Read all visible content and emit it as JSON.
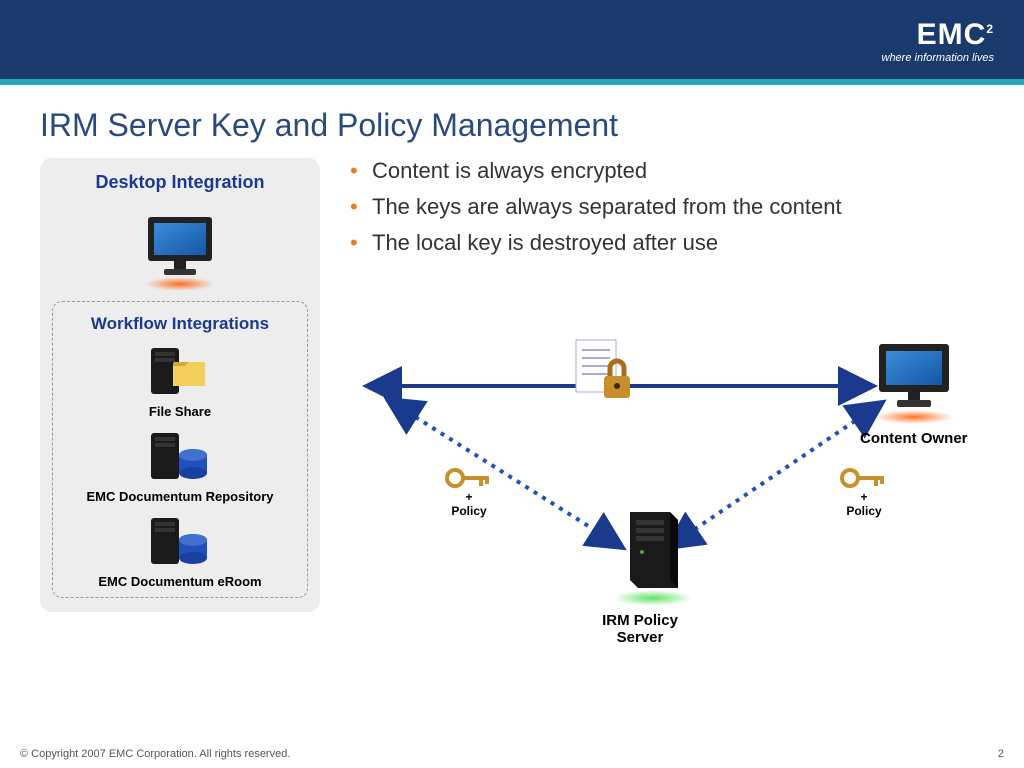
{
  "brand": {
    "name": "EMC",
    "sup": "2",
    "tagline": "where information lives"
  },
  "title": "IRM Server Key and Policy Management",
  "sidebar": {
    "desktop_title": "Desktop Integration",
    "workflow_title": "Workflow Integrations",
    "items": [
      {
        "label": "File Share"
      },
      {
        "label": "EMC Documentum Repository"
      },
      {
        "label": "EMC Documentum eRoom"
      }
    ]
  },
  "bullets": [
    "Content is always encrypted",
    "The keys are always separated from the content",
    "The local key is destroyed after use"
  ],
  "diagram": {
    "content_owner": "Content Owner",
    "irm_server": "IRM Policy Server",
    "policy_left": "+\nPolicy",
    "policy_right": "+\nPolicy"
  },
  "footer": {
    "copyright": "© Copyright 2007 EMC Corporation. All rights reserved.",
    "page": "2"
  }
}
